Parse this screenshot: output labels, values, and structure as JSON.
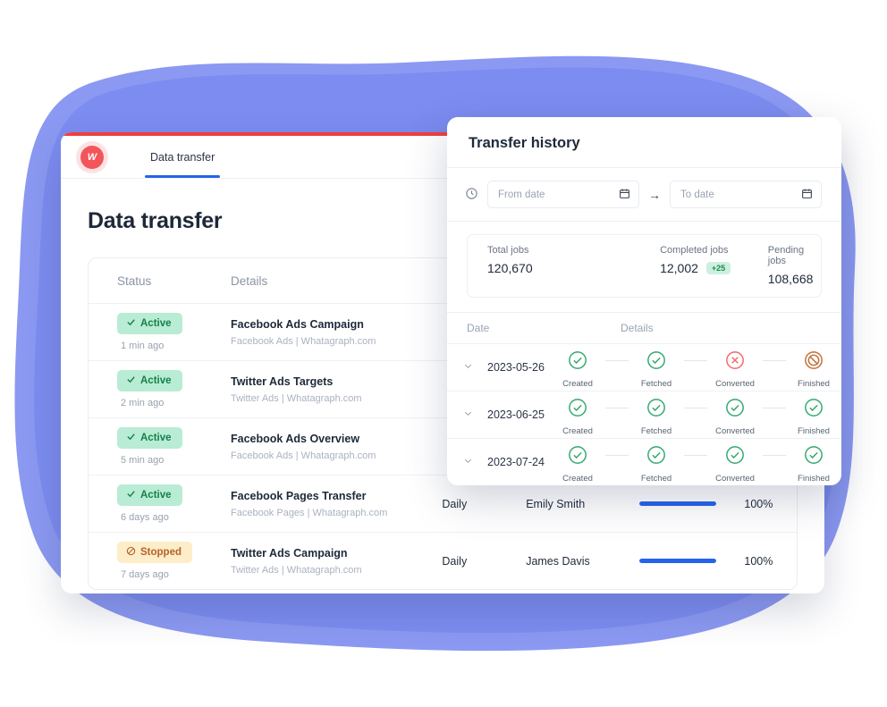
{
  "theme": {
    "blob_color": "#7c8cf0",
    "blob_color_light": "#8e9cf2",
    "accent_red": "#f03e3e",
    "accent_blue": "#2563eb",
    "green": "#15804a",
    "amber": "#b4622a"
  },
  "app": {
    "logo_icon": "whatagraph-logo-icon",
    "logo_letter": "W",
    "tabs": [
      {
        "label": "Data transfer",
        "active": true
      }
    ],
    "page_title": "Data transfer"
  },
  "table": {
    "headers": {
      "status": "Status",
      "details": "Details"
    },
    "rows": [
      {
        "status": "Active",
        "status_type": "active",
        "status_icon": "check-icon",
        "ago": "1 min ago",
        "title": "Facebook Ads Campaign",
        "source": "Facebook Ads | Whatagraph.com",
        "frequency": "",
        "owner": "",
        "progress": null,
        "percent": ""
      },
      {
        "status": "Active",
        "status_type": "active",
        "status_icon": "check-icon",
        "ago": "2 min ago",
        "title": "Twitter Ads Targets",
        "source": "Twitter Ads | Whatagraph.com",
        "frequency": "",
        "owner": "",
        "progress": null,
        "percent": ""
      },
      {
        "status": "Active",
        "status_type": "active",
        "status_icon": "check-icon",
        "ago": "5 min ago",
        "title": "Facebook Ads Overview",
        "source": "Facebook Ads | Whatagraph.com",
        "frequency": "",
        "owner": "",
        "progress": null,
        "percent": ""
      },
      {
        "status": "Active",
        "status_type": "active",
        "status_icon": "check-icon",
        "ago": "6 days ago",
        "title": "Facebook Pages Transfer",
        "source": "Facebook Pages | Whatagraph.com",
        "frequency": "Daily",
        "owner": "Emily Smith",
        "progress": 100,
        "percent": "100%"
      },
      {
        "status": "Stopped",
        "status_type": "stopped",
        "status_icon": "block-icon",
        "ago": "7 days ago",
        "title": "Twitter Ads Campaign",
        "source": "Twitter Ads | Whatagraph.com",
        "frequency": "Daily",
        "owner": "James Davis",
        "progress": 100,
        "percent": "100%"
      }
    ]
  },
  "modal": {
    "title": "Transfer history",
    "clock_icon": "clock-icon",
    "filter": {
      "from_placeholder": "From date",
      "from_value": "",
      "to_placeholder": "To date",
      "to_value": "",
      "arrow_icon": "arrow-right-icon",
      "calendar_icon": "calendar-icon"
    },
    "stats": [
      {
        "label": "Total jobs",
        "value": "120,670",
        "delta": ""
      },
      {
        "label": "Completed jobs",
        "value": "12,002",
        "delta": "+25"
      },
      {
        "label": "Pending jobs",
        "value": "108,668",
        "delta": ""
      }
    ],
    "history_headers": {
      "date": "Date",
      "details": "Details"
    },
    "step_labels": [
      "Created",
      "Fetched",
      "Converted",
      "Finished"
    ],
    "history": [
      {
        "date": "2023-05-26",
        "chevron_icon": "chevron-down-icon",
        "steps": [
          "ok",
          "ok",
          "error",
          "blocked"
        ]
      },
      {
        "date": "2023-06-25",
        "chevron_icon": "chevron-down-icon",
        "steps": [
          "ok",
          "ok",
          "ok",
          "ok"
        ]
      },
      {
        "date": "2023-07-24",
        "chevron_icon": "chevron-down-icon",
        "steps": [
          "ok",
          "ok",
          "ok",
          "ok"
        ]
      }
    ]
  }
}
